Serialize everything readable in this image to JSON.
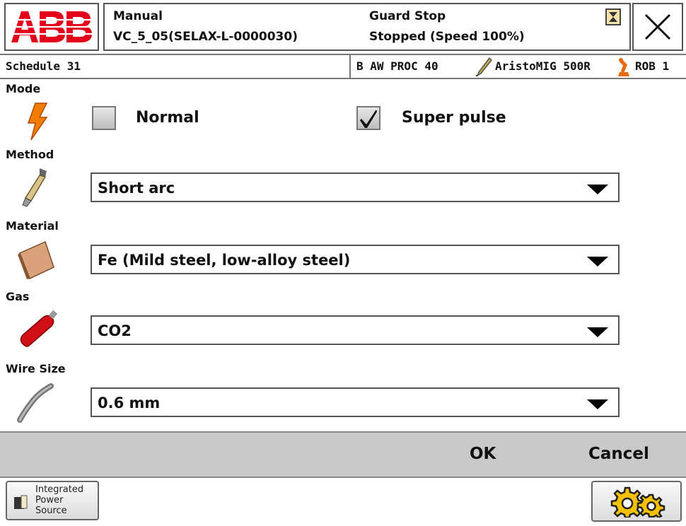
{
  "header": {
    "mode": "Manual",
    "controller": "VC_5_05(SELAX-L-0000030)",
    "state": "Guard Stop",
    "run_status": "Stopped (Speed 100%)"
  },
  "subbar": {
    "title": "Schedule 31",
    "process": "B AW PROC 40",
    "power_source": "AristoMIG 500R",
    "robot": "ROB 1"
  },
  "form": {
    "mode": {
      "label": "Mode",
      "options": [
        {
          "label": "Normal",
          "checked": false
        },
        {
          "label": "Super pulse",
          "checked": true
        }
      ]
    },
    "method": {
      "label": "Method",
      "value": "Short arc"
    },
    "material": {
      "label": "Material",
      "value": "Fe (Mild steel, low-alloy steel)"
    },
    "gas": {
      "label": "Gas",
      "value": "CO2"
    },
    "wire_size": {
      "label": "Wire Size",
      "value": "0.6 mm"
    }
  },
  "actions": {
    "ok_label": "OK",
    "cancel_label": "Cancel"
  },
  "taskbar": {
    "app_label": "Integrated Power Source"
  },
  "colors": {
    "abb_red": "#e2001a",
    "action_bar": "#c9c9c9",
    "bolt_orange": "#f07d00",
    "gas_red": "#d10f17",
    "gear_yellow": "#f5c000"
  },
  "icons": {
    "mode": "lightning-bolt-icon",
    "method": "welding-torch-icon",
    "material": "material-plate-icon",
    "gas": "gas-cylinder-icon",
    "wire": "wire-icon",
    "close": "close-icon",
    "operator_window": "operator-window-icon",
    "torch_small": "torch-icon",
    "robot": "robot-icon",
    "task": "power-source-icon",
    "quickset": "gears-icon"
  }
}
